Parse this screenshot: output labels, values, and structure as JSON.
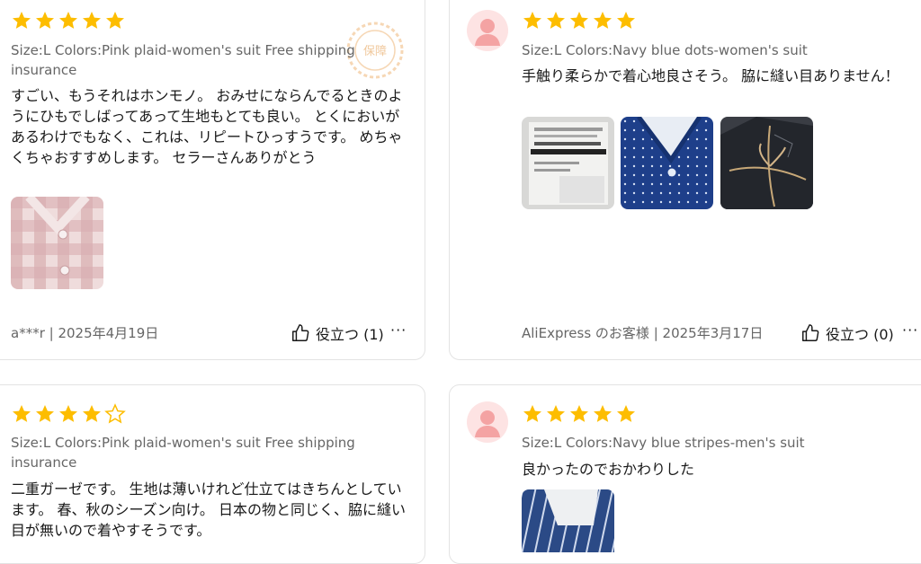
{
  "reviews": [
    {
      "rating": 5,
      "variant": "Size:L Colors:Pink plaid-women's suit Free shipping insurance",
      "text": "すごい、もうそれはホンモノ。 おみせにならんでるときのようにひもでしばってあって生地もとても良い。 とくにおいがあるわけでもなく、これは、リピートひっすうです。 めちゃくちゃおすすめします。 セラーさんありがとう",
      "author": "a***r",
      "date": "2025年4月19日",
      "helpful": "役立つ (1)",
      "more": "···"
    },
    {
      "rating": 5,
      "variant": "Size:L Colors:Navy blue dots-women's suit",
      "text": "手触り柔らかで着心地良さそう。 脇に縫い目ありません！",
      "author": "AliExpress のお客様",
      "date": "2025年3月17日",
      "helpful": "役立つ (0)",
      "more": "···"
    },
    {
      "rating": 4,
      "variant": "Size:L Colors:Pink plaid-women's suit Free shipping insurance",
      "text": "二重ガーゼです。 生地は薄いけれど仕立てはきちんとしています。 春、秋のシーズン向け。 日本の物と同じく、脇に縫い目が無いので着やすそうです。"
    },
    {
      "rating": 5,
      "variant": "Size:L Colors:Navy blue stripes-men's suit",
      "text": "良かったのでおかわりした"
    }
  ],
  "colors": {
    "star": "#fdbd00",
    "text": "#191919",
    "muted": "#666666",
    "border": "#e3e3e3",
    "avatar_bg": "#fde3e3",
    "avatar_fg": "#f4a3a3"
  },
  "icons": [
    "star-icon",
    "star-outline-icon",
    "thumbs-up-icon",
    "user-avatar-icon",
    "more-icon"
  ],
  "seal_text": "保障"
}
